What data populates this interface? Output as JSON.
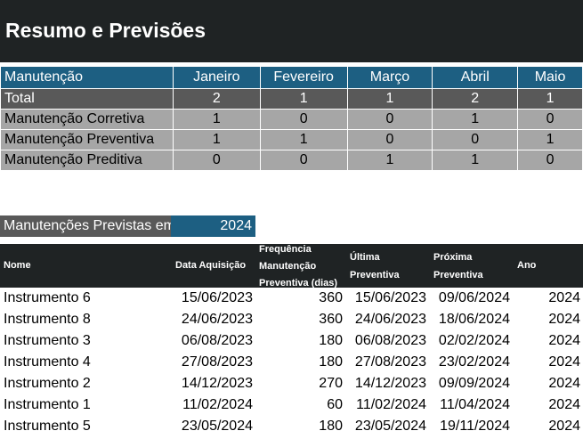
{
  "title": "Resumo e Previsões",
  "summary": {
    "header_label": "Manutenção",
    "months": [
      "Janeiro",
      "Fevereiro",
      "Março",
      "Abril",
      "Maio"
    ],
    "rows": [
      {
        "label": "Total",
        "values": [
          "2",
          "1",
          "1",
          "2",
          "1"
        ]
      },
      {
        "label": "Manutenção Corretiva",
        "values": [
          "1",
          "0",
          "0",
          "1",
          "0"
        ]
      },
      {
        "label": "Manutenção Preventiva",
        "values": [
          "1",
          "1",
          "0",
          "0",
          "1"
        ]
      },
      {
        "label": "Manutenção Preditiva",
        "values": [
          "0",
          "0",
          "1",
          "1",
          "0"
        ]
      }
    ]
  },
  "forecast": {
    "label": "Manutenções Previstas em",
    "year": "2024",
    "columns": {
      "name": "Nome",
      "acq": "Data Aquisição",
      "freq1": "Frequência",
      "freq2": "Manutenção",
      "freq3": "Preventiva (dias)",
      "last1": "Última",
      "last2": "Preventiva",
      "next1": "Próxima",
      "next2": "Preventiva",
      "year": "Ano"
    },
    "rows": [
      {
        "name": "Instrumento 6",
        "acq": "15/06/2023",
        "freq": "360",
        "last": "15/06/2023",
        "next": "09/06/2024",
        "year": "2024"
      },
      {
        "name": "Instrumento 8",
        "acq": "24/06/2023",
        "freq": "360",
        "last": "24/06/2023",
        "next": "18/06/2024",
        "year": "2024"
      },
      {
        "name": "Instrumento 3",
        "acq": "06/08/2023",
        "freq": "180",
        "last": "06/08/2023",
        "next": "02/02/2024",
        "year": "2024"
      },
      {
        "name": "Instrumento 4",
        "acq": "27/08/2023",
        "freq": "180",
        "last": "27/08/2023",
        "next": "23/02/2024",
        "year": "2024"
      },
      {
        "name": "Instrumento 2",
        "acq": "14/12/2023",
        "freq": "270",
        "last": "14/12/2023",
        "next": "09/09/2024",
        "year": "2024"
      },
      {
        "name": "Instrumento 1",
        "acq": "11/02/2024",
        "freq": "60",
        "last": "11/02/2024",
        "next": "11/04/2024",
        "year": "2024"
      },
      {
        "name": "Instrumento 5",
        "acq": "23/05/2024",
        "freq": "180",
        "last": "23/05/2024",
        "next": "19/11/2024",
        "year": "2024"
      }
    ]
  }
}
